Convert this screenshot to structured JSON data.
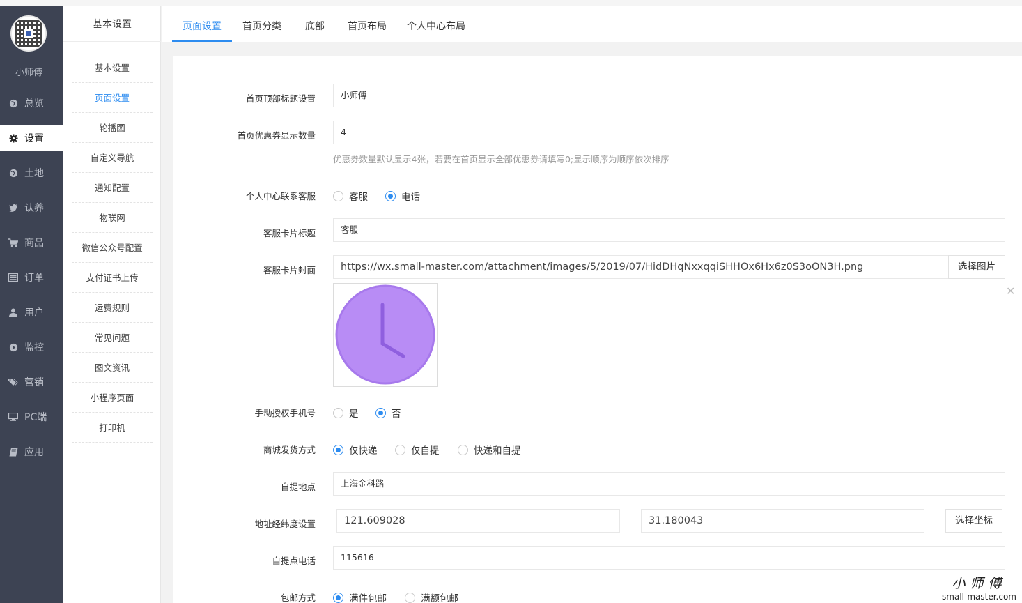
{
  "sidebar": {
    "shop_name": "小师傅",
    "items": [
      {
        "label": "总览",
        "icon": "globe-icon"
      },
      {
        "label": "设置",
        "icon": "gear-icon"
      },
      {
        "label": "土地",
        "icon": "globe-icon"
      },
      {
        "label": "认养",
        "icon": "twitter-bird-icon"
      },
      {
        "label": "商品",
        "icon": "cart-icon"
      },
      {
        "label": "订单",
        "icon": "list-icon"
      },
      {
        "label": "用户",
        "icon": "user-icon"
      },
      {
        "label": "监控",
        "icon": "play-icon"
      },
      {
        "label": "营销",
        "icon": "tags-icon"
      },
      {
        "label": "PC端",
        "icon": "desktop-icon"
      },
      {
        "label": "应用",
        "icon": "book-icon"
      }
    ],
    "active_index": 1
  },
  "submenu": {
    "title": "基本设置",
    "items": [
      "基本设置",
      "页面设置",
      "轮播图",
      "自定义导航",
      "通知配置",
      "物联网",
      "微信公众号配置",
      "支付证书上传",
      "运费规则",
      "常见问题",
      "图文资讯",
      "小程序页面",
      "打印机"
    ],
    "active_index": 1
  },
  "tabs": {
    "items": [
      "页面设置",
      "首页分类",
      "底部",
      "首页布局",
      "个人中心布局"
    ],
    "active_index": 0
  },
  "form": {
    "home_title": {
      "label": "首页顶部标题设置",
      "value": "小师傅"
    },
    "coupon_count": {
      "label": "首页优惠券显示数量",
      "value": "4",
      "hint": "优惠券数量默认显示4张，若要在首页显示全部优惠券请填写0;显示顺序为顺序依次排序"
    },
    "contact": {
      "label": "个人中心联系客服",
      "options": [
        "客服",
        "电话"
      ],
      "selected": 1
    },
    "card_title": {
      "label": "客服卡片标题",
      "value": "客服"
    },
    "card_cover": {
      "label": "客服卡片封面",
      "value": "https://wx.small-master.com/attachment/images/5/2019/07/HidDHqNxxqqiSHHOx6Hx6z0S3oON3H.png",
      "button": "选择图片",
      "clock_color": "#b88cf5"
    },
    "manual_phone": {
      "label": "手动授权手机号",
      "options": [
        "是",
        "否"
      ],
      "selected": 1
    },
    "delivery": {
      "label": "商城发货方式",
      "options": [
        "仅快递",
        "仅自提",
        "快递和自提"
      ],
      "selected": 0
    },
    "pickup_address": {
      "label": "自提地点",
      "value": "上海金科路"
    },
    "coords": {
      "label": "地址经纬度设置",
      "lng": "121.609028",
      "lat": "31.180043",
      "button": "选择坐标"
    },
    "pickup_phone": {
      "label": "自提点电话",
      "value": "115616"
    },
    "shipping": {
      "label": "包邮方式",
      "options": [
        "满件包邮",
        "满额包邮"
      ],
      "selected": 0
    }
  },
  "watermark": {
    "line1": "小师傅",
    "line2": "small-master.com"
  },
  "colors": {
    "accent": "#2d8cf0",
    "nav_bg": "#3d4353"
  }
}
